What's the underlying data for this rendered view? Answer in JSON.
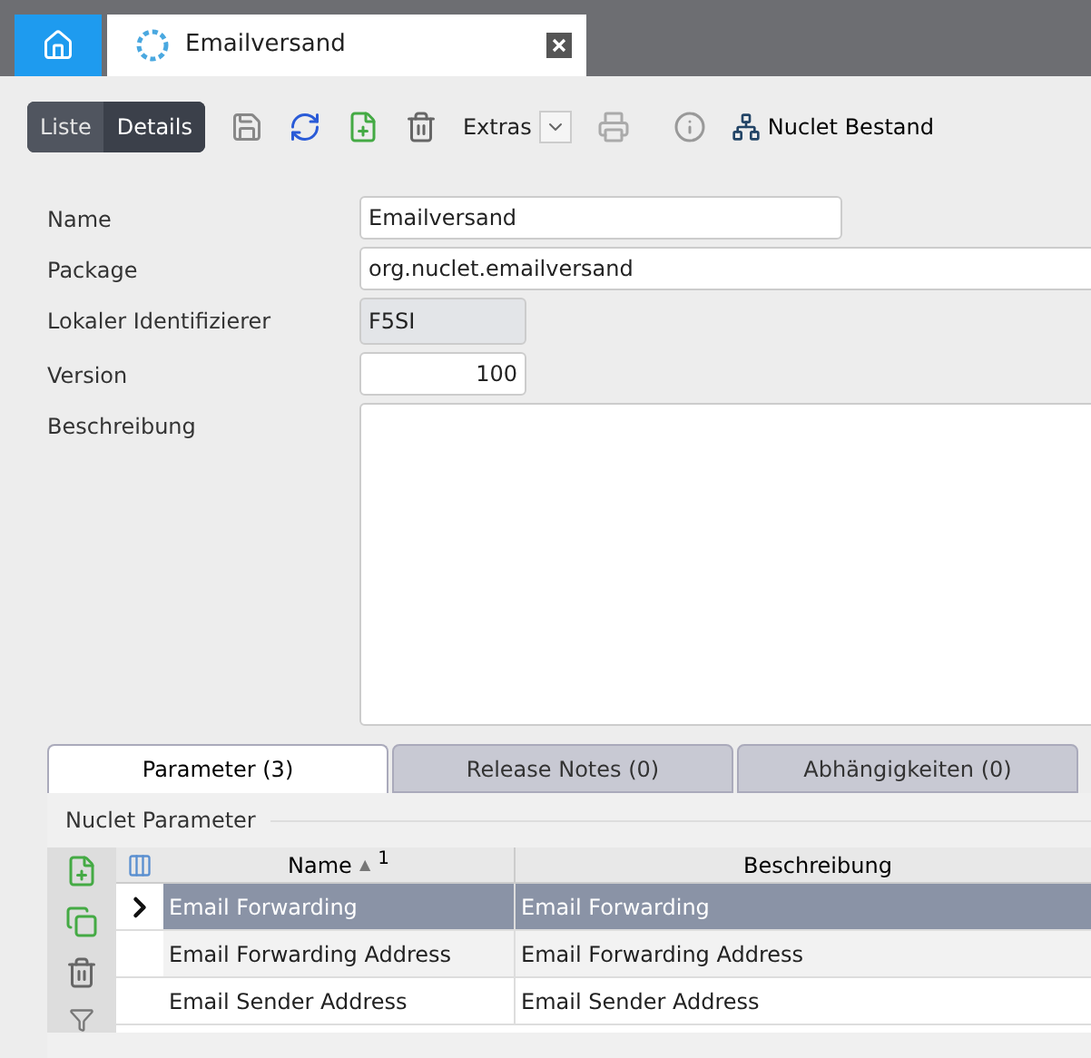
{
  "top_tabs": [
    {
      "kind": "home",
      "selected": false
    },
    {
      "kind": "document",
      "label": "Emailversand",
      "selected": true
    }
  ],
  "toolbar": {
    "views": [
      {
        "label": "Liste",
        "selected": false
      },
      {
        "label": "Details",
        "selected": true
      }
    ],
    "extras": "Extras",
    "nuclet_button": "Nuclet Bestand"
  },
  "form": [
    {
      "label": "Name",
      "value": "Emailversand",
      "kind": "text",
      "editable": true
    },
    {
      "label": "Package",
      "value": "org.nuclet.emailversand",
      "kind": "wide",
      "editable": true
    },
    {
      "label": "Lokaler Identifizierer",
      "value": "F5SI",
      "kind": "short",
      "editable": false
    },
    {
      "label": "Version",
      "value": "100",
      "kind": "number",
      "editable": true
    },
    {
      "label": "Beschreibung",
      "kind": "area",
      "editable": true
    }
  ],
  "sub_tabs": [
    {
      "label": "Parameter (3)",
      "selected": true
    },
    {
      "label": "Release Notes (0)",
      "selected": false
    },
    {
      "label": "Abhängigkeiten (0)",
      "selected": false
    }
  ],
  "group_title": "Nuclet Parameter",
  "table": {
    "columns": [
      {
        "label": "Name",
        "sort": "▲",
        "sort_index": "1"
      },
      {
        "label": "Beschreibung"
      }
    ],
    "rows": [
      {
        "name": "Email Forwarding",
        "description": "Email Forwarding",
        "selected": true
      },
      {
        "name": "Email Forwarding Address",
        "description": "Email Forwarding Address",
        "selected": false
      },
      {
        "name": "Email Sender Address",
        "description": "Email Sender Address",
        "selected": false
      }
    ]
  }
}
